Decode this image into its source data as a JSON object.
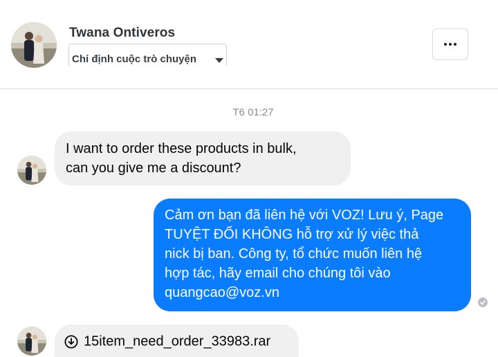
{
  "header": {
    "contact_name": "Twana Ontiveros",
    "assign_label": "Chỉ định cuộc trò chuyện",
    "more_icon": "more-horizontal-icon"
  },
  "conversation": {
    "timestamp": "T6 01:27",
    "messages": [
      {
        "direction": "incoming",
        "lines": [
          "I want to order these products in bulk,",
          "can you give me a discount?"
        ]
      },
      {
        "direction": "outgoing",
        "lines": [
          "Cảm ơn bạn đã liên hệ với VOZ! Lưu ý, Page",
          "TUYỆT ĐỐI KHÔNG hỗ trợ xử lý việc thả",
          "nick bị ban. Công ty, tổ chức muốn liên hệ",
          "hợp tác, hãy email cho chúng tôi vào",
          "quangcao@voz.vn"
        ],
        "status_icon": "seen-check-icon"
      },
      {
        "direction": "incoming",
        "type": "file",
        "icon": "download-icon",
        "filename": "15item_need_order_33983.rar"
      }
    ]
  },
  "colors": {
    "outgoing_bubble": "#0a7cff",
    "incoming_bubble": "#f0f0f0",
    "timestamp": "#8a8d91"
  }
}
